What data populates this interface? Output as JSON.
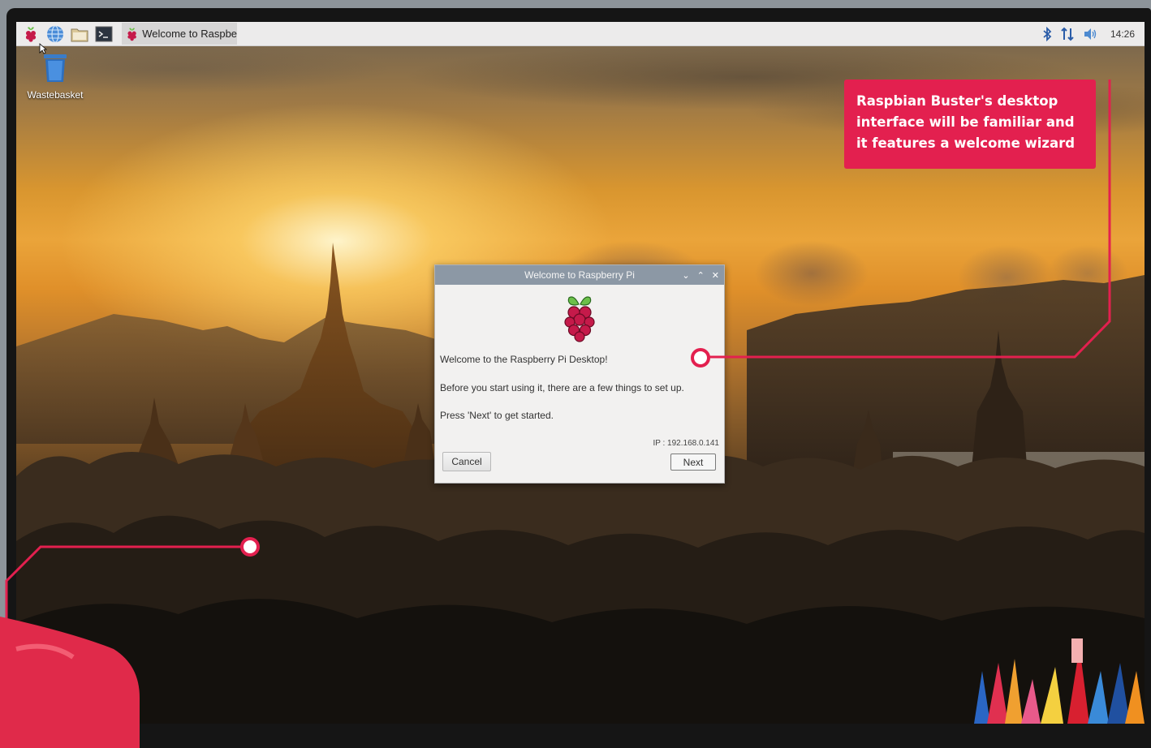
{
  "taskbar": {
    "launchers": [
      "raspberry-menu-icon",
      "web-browser-icon",
      "file-manager-icon",
      "terminal-icon"
    ],
    "window_button": {
      "label": "Welcome to Raspberr..."
    },
    "tray": {
      "icons": [
        "bluetooth-icon",
        "network-icon",
        "volume-icon"
      ],
      "clock": "14:26"
    }
  },
  "desktop": {
    "icons": [
      {
        "label": "Wastebasket",
        "icon": "wastebasket-icon"
      }
    ]
  },
  "dialog": {
    "title": "Welcome to Raspberry Pi",
    "line1": "Welcome to the Raspberry Pi Desktop!",
    "line2": "Before you start using it, there are a few things to set up.",
    "line3": "Press 'Next' to get started.",
    "ip": "IP : 192.168.0.141",
    "cancel_label": "Cancel",
    "next_label": "Next"
  },
  "annotation": {
    "text": "Raspbian Buster's desktop interface will be familiar and it features a welcome wizard",
    "color": "#e3204f"
  },
  "colors": {
    "accent": "#e3204f",
    "titlebar": "#8c98a5",
    "raspberry": "#c51a4a",
    "leaf": "#6cc04a"
  }
}
